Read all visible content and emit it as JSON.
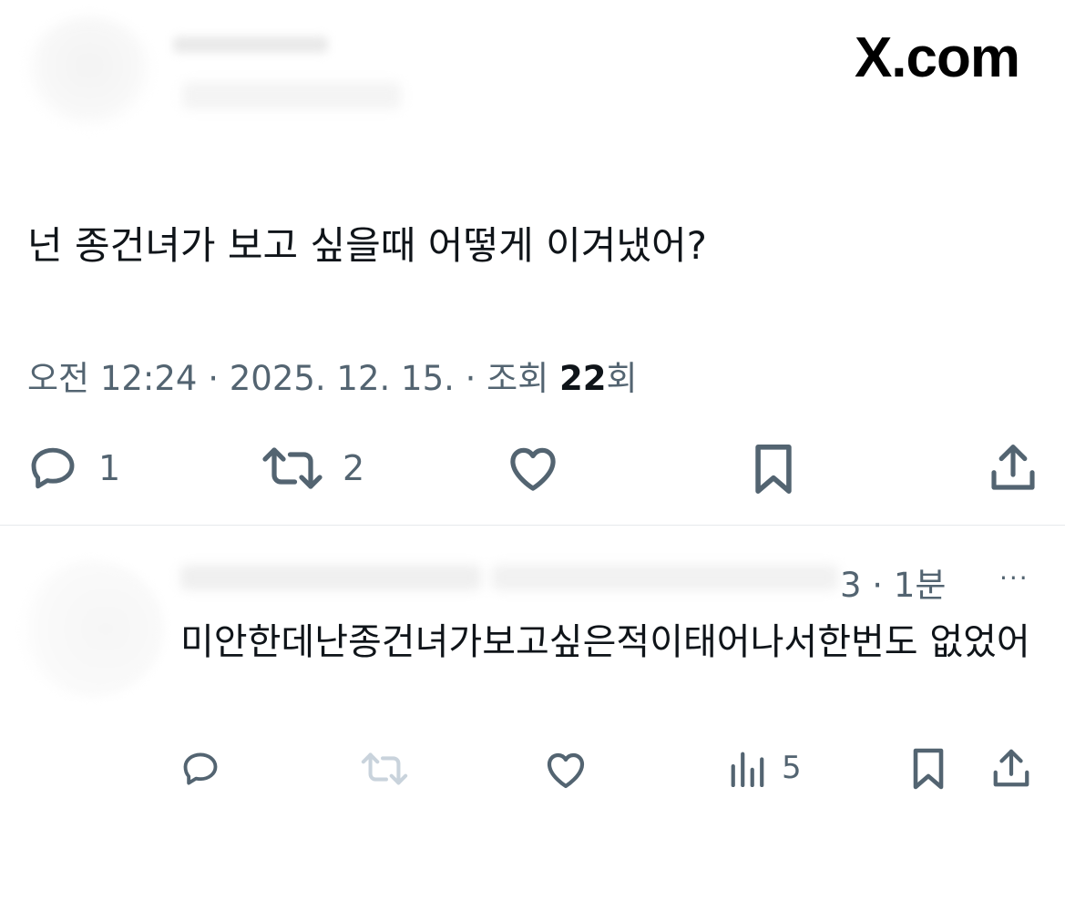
{
  "brand": {
    "site": "X.com"
  },
  "tweet": {
    "text": "넌 종건녀가 보고 싶을때 어떻게 이겨냈어?",
    "meta_prefix": "오전 12:24 · 2025. 12. 15. · 조회 ",
    "view_count": "22",
    "view_suffix": "회",
    "actions": {
      "replies": "1",
      "reposts": "2"
    }
  },
  "reply": {
    "time": "3 · 1분",
    "more": "···",
    "text": "미안한데난종건녀가보고싶은적이태어나서한번도 없었어",
    "actions": {
      "views": "5"
    }
  },
  "colors": {
    "text": "#0f1419",
    "muted": "#536471",
    "divider": "#e6e9ec",
    "disabled_icon": "#c9d3dc"
  },
  "icons": [
    "reply-icon",
    "repost-icon",
    "like-icon",
    "bookmark-icon",
    "share-icon",
    "views-icon",
    "more-icon"
  ]
}
